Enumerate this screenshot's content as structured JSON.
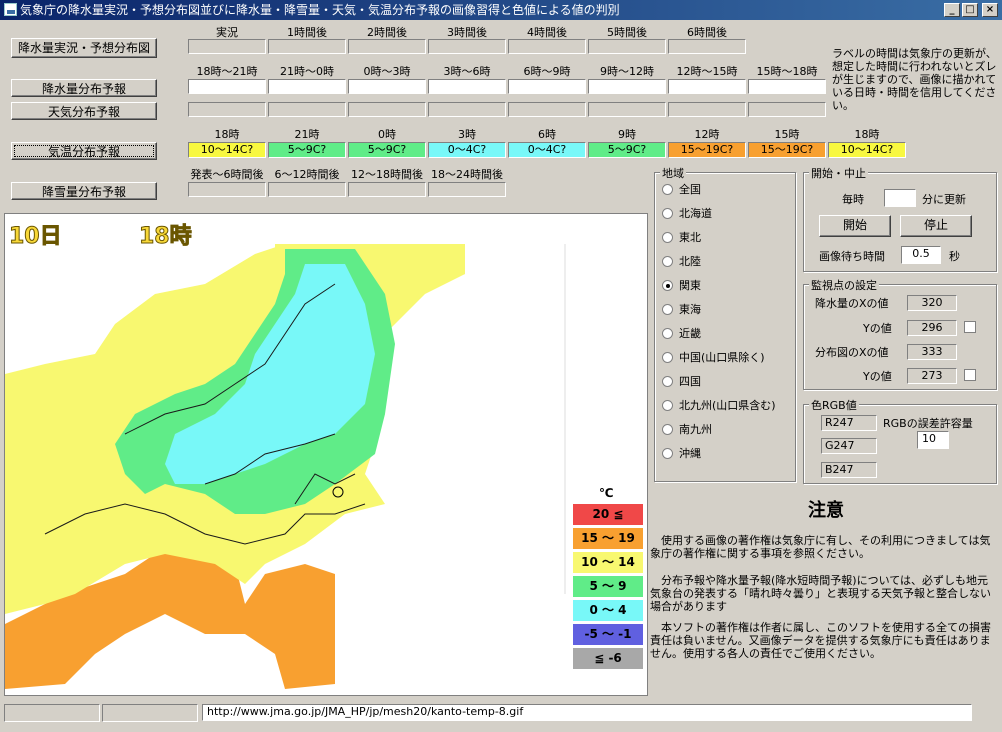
{
  "window": {
    "title": "気象庁の降水量実況・予想分布図並びに降水量・降雪量・天気・気温分布予報の画像習得と色値による値の判別",
    "controls": {
      "minimize": "_",
      "maximize": "□",
      "close": "×"
    }
  },
  "left_buttons": {
    "precip_actual": "降水量実況・予想分布図",
    "precip_forecast": "降水量分布予報",
    "weather_forecast": "天気分布予報",
    "temp_forecast": "気温分布予報",
    "snow_forecast": "降雪量分布予報"
  },
  "precip_headers": [
    "実況",
    "1時間後",
    "2時間後",
    "3時間後",
    "4時間後",
    "5時間後",
    "6時間後"
  ],
  "forecast_headers": [
    "18時～21時",
    "21時～0時",
    "0時～3時",
    "3時～6時",
    "6時～9時",
    "9時～12時",
    "12時～15時",
    "15時～18時"
  ],
  "temp_headers": [
    "18時",
    "21時",
    "0時",
    "3時",
    "6時",
    "9時",
    "12時",
    "15時",
    "18時"
  ],
  "temp_values": [
    {
      "text": "10～14C?",
      "color": "#f8f840"
    },
    {
      "text": "5～9C?",
      "color": "#60ec88"
    },
    {
      "text": "5～9C?",
      "color": "#60ec88"
    },
    {
      "text": "0～4C?",
      "color": "#78f8f8"
    },
    {
      "text": "0～4C?",
      "color": "#78f8f8"
    },
    {
      "text": "5～9C?",
      "color": "#60ec88"
    },
    {
      "text": "15～19C?",
      "color": "#f8a030"
    },
    {
      "text": "15～19C?",
      "color": "#f8a030"
    },
    {
      "text": "10～14C?",
      "color": "#f8f840"
    }
  ],
  "snow_headers": [
    "発表～6時間後",
    "6～12時間後",
    "12～18時間後",
    "18～24時間後"
  ],
  "label_note": "ラベルの時間は気象庁の更新が、想定した時間に行われないとズレが生じますので、画像に描かれている日時・時間を信用してください。",
  "map": {
    "day": "10日",
    "hour": "18時",
    "legend_unit": "℃",
    "legend": [
      {
        "label": "20 ≦",
        "color": "#f04848"
      },
      {
        "label": "15 ～ 19",
        "color": "#f8a030"
      },
      {
        "label": "10 ～ 14",
        "color": "#f8f870"
      },
      {
        "label": "5 ～ 9",
        "color": "#60ec88"
      },
      {
        "label": "0 ～ 4",
        "color": "#78f8f8"
      },
      {
        "label": "-5 ～ -1",
        "color": "#6060e0"
      },
      {
        "label": "≦ -6",
        "color": "#a8a8a8"
      }
    ]
  },
  "region": {
    "title": "地域",
    "selected": "関東",
    "options": [
      "全国",
      "北海道",
      "東北",
      "北陸",
      "関東",
      "東海",
      "近畿",
      "中国(山口県除く)",
      "四国",
      "北九州(山口県含む)",
      "南九州",
      "沖縄"
    ]
  },
  "startstop": {
    "title": "開始・中止",
    "every_label": "毎時",
    "update_suffix": "分に更新",
    "minute_value": "",
    "start": "開始",
    "stop": "停止",
    "wait_label": "画像待ち時間",
    "wait_value": "0.5",
    "wait_unit": "秒"
  },
  "monitor": {
    "title": "監視点の設定",
    "precip_x_label": "降水量のXの値",
    "precip_x": "320",
    "precip_y_label": "Yの値",
    "precip_y": "296",
    "dist_x_label": "分布図のXの値",
    "dist_x": "333",
    "dist_y_label": "Yの値",
    "dist_y": "273"
  },
  "rgb": {
    "title": "色RGB値",
    "r": "R247",
    "g": "G247",
    "b": "B247",
    "tolerance_label": "RGBの誤差許容量",
    "tolerance_value": "10"
  },
  "notice": {
    "title": "注意",
    "p1": "使用する画像の著作権は気象庁に有し、その利用につきましては気象庁の著作権に関する事項を参照ください。",
    "p2": "分布予報や降水量予報(降水短時間予報)については、必ずしも地元気象台の発表する「晴れ時々曇り」と表現する天気予報と整合しない場合があります",
    "p3": "本ソフトの著作権は作者に属し、このソフトを使用する全ての損害責任は負いません。又画像データを提供する気象庁にも責任はありません。使用する各人の責任でご使用ください。"
  },
  "status_bar": {
    "url": "http://www.jma.go.jp/JMA_HP/jp/mesh20/kanto-temp-8.gif"
  }
}
